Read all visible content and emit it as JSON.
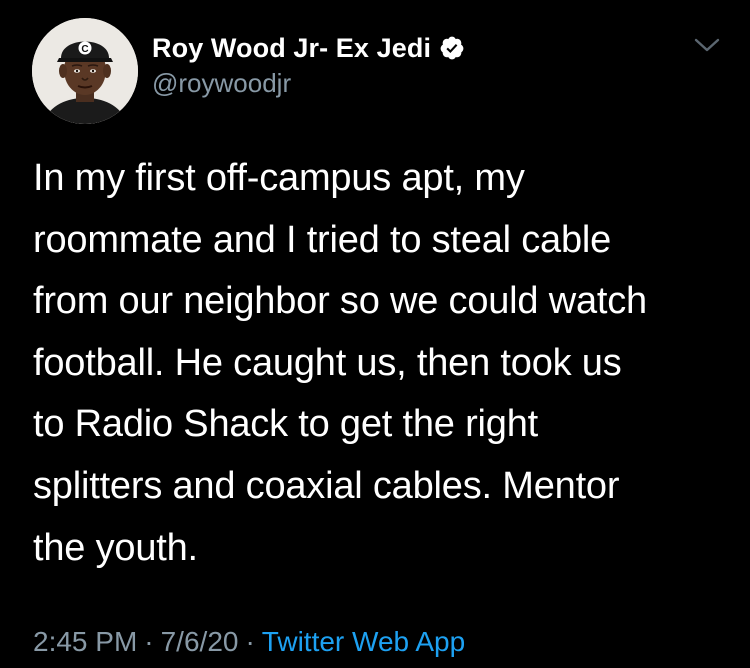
{
  "author": {
    "display_name": "Roy Wood Jr- Ex Jedi",
    "handle": "@roywoodjr",
    "verified_icon": "verified-badge-icon",
    "avatar_icon": "avatar-photo",
    "cap_letter": "C"
  },
  "menu": {
    "icon": "chevron-down-icon"
  },
  "tweet": {
    "lines": [
      "In my first off-campus apt, my",
      "roommate and I tried to steal cable",
      "from our neighbor so we could watch",
      "football. He caught us, then took us",
      "to Radio Shack to get the right",
      "splitters and coaxial cables. Mentor",
      "the youth."
    ]
  },
  "meta": {
    "time": "2:45 PM",
    "separator": "·",
    "date": "7/6/20",
    "source": "Twitter Web App"
  },
  "colors": {
    "background": "#000000",
    "text_primary": "#ffffff",
    "text_secondary": "#8899a6",
    "link": "#1da1f2"
  }
}
